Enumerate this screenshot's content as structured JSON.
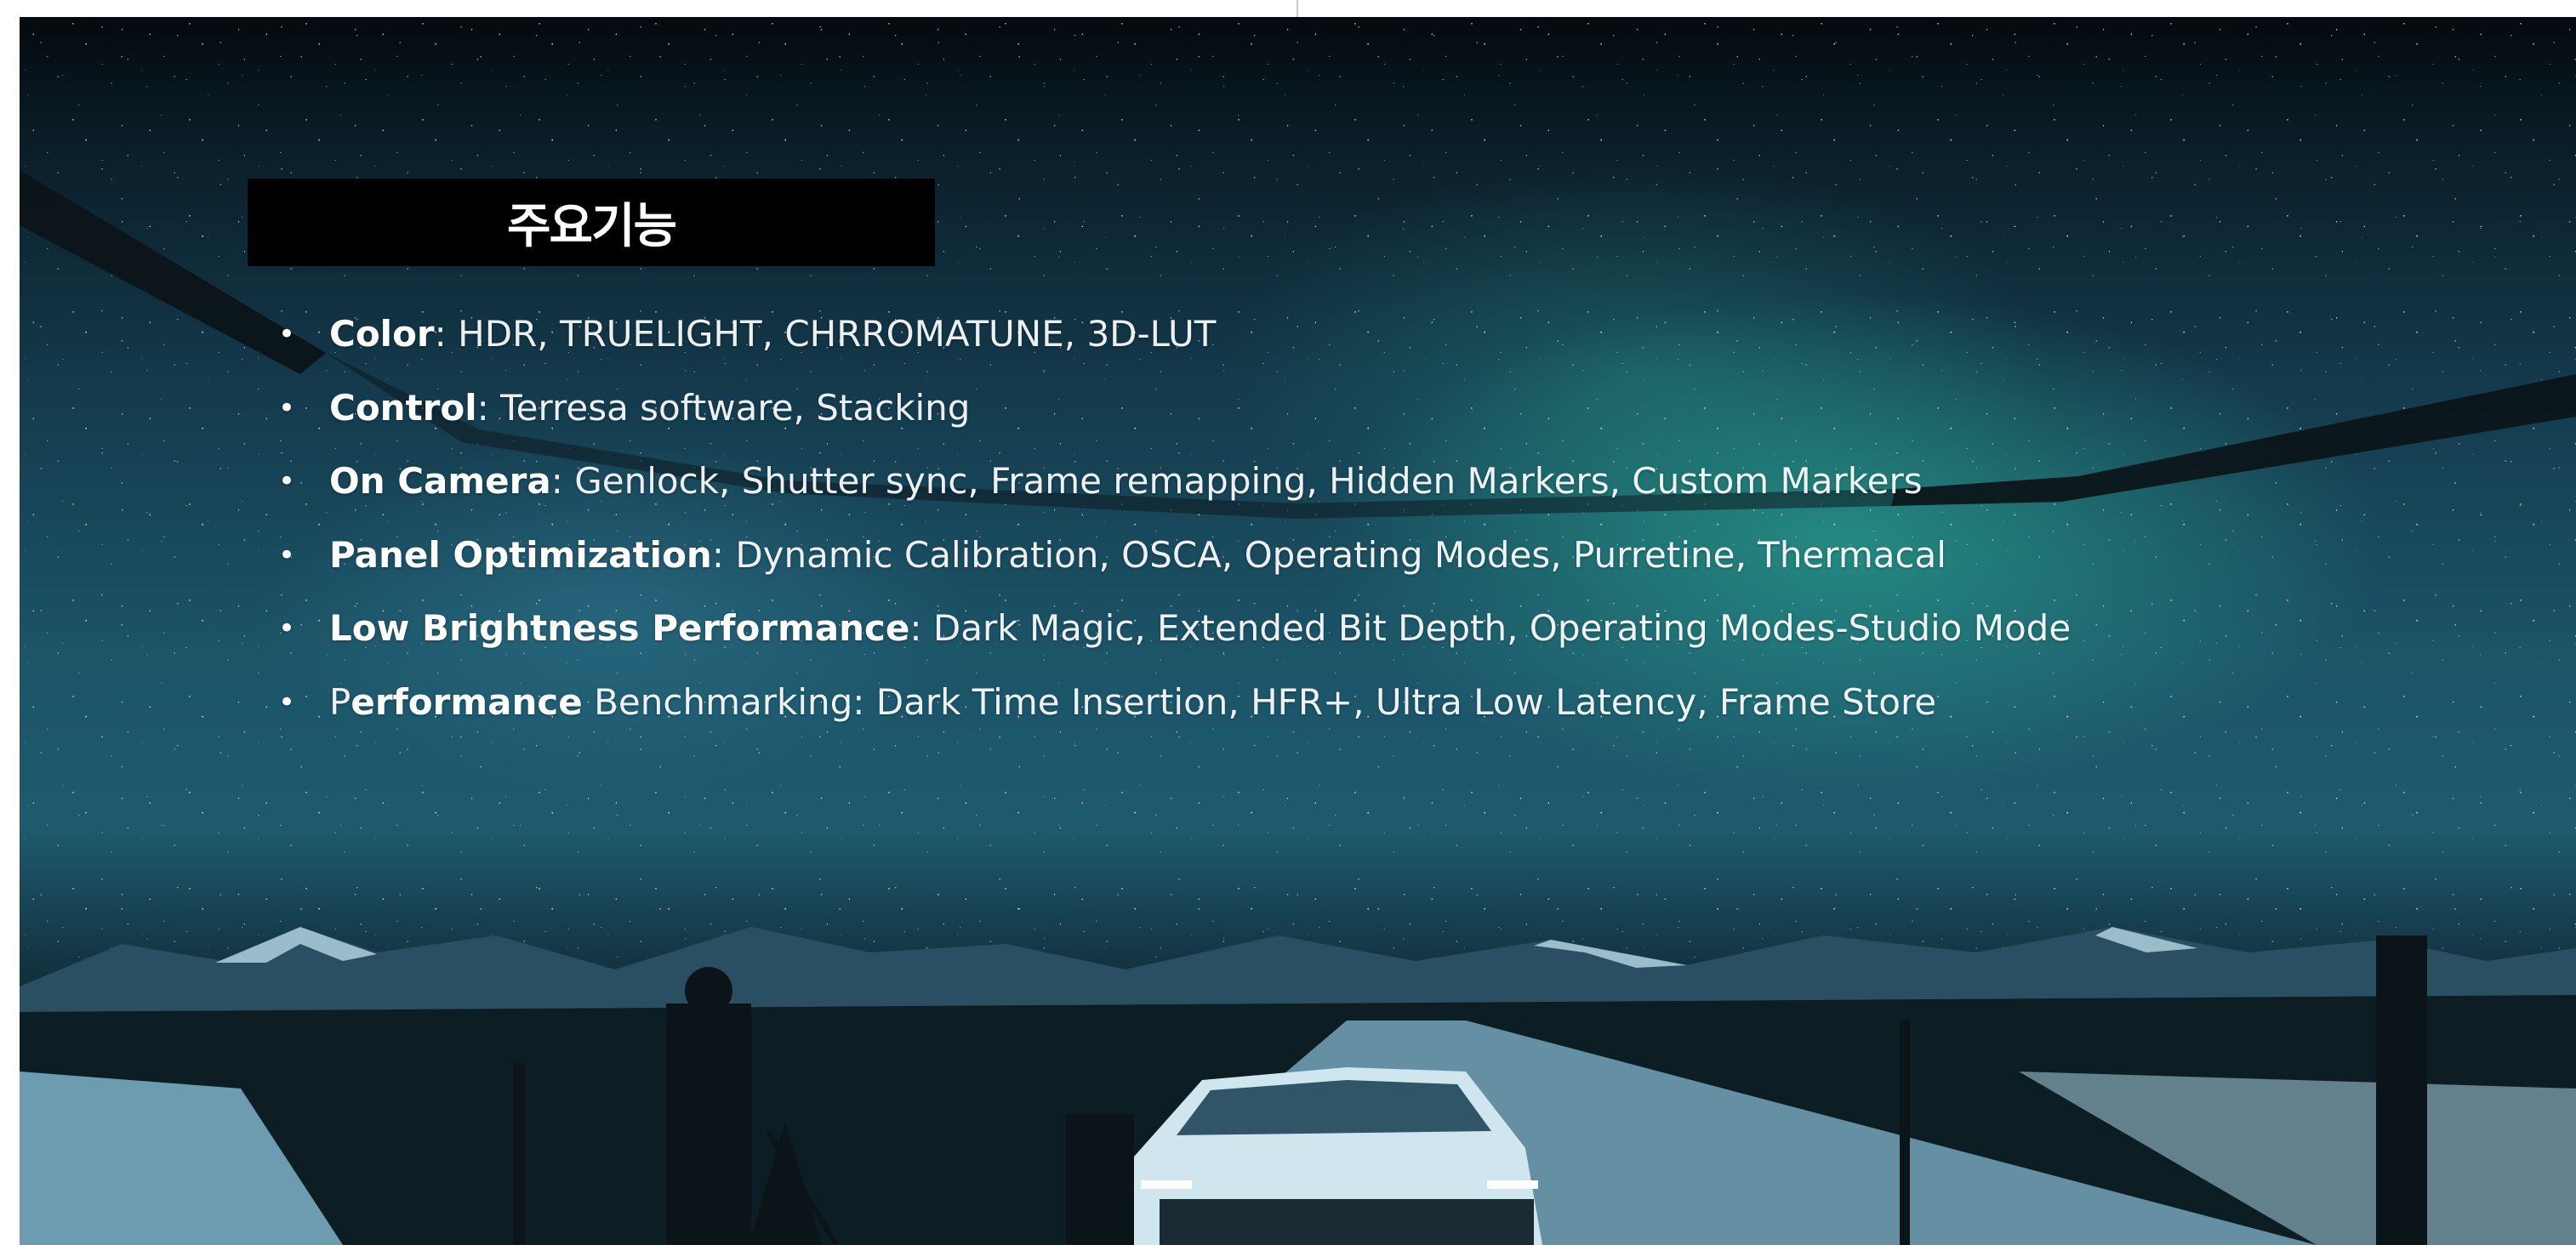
{
  "slide": {
    "title": "주요기능",
    "features": [
      {
        "bold": "Color",
        "rest": ": HDR, TRUELIGHT, CHRROMATUNE, 3D-LUT"
      },
      {
        "bold": "Control",
        "rest": ": Terresa software, Stacking"
      },
      {
        "bold": "On Camera",
        "rest": ": Genlock, Shutter sync, Frame remapping, Hidden Markers, Custom Markers"
      },
      {
        "bold": "Panel Optimization",
        "rest": ": Dynamic Calibration, OSCA, Operating Modes, Purretine, Thermacal"
      },
      {
        "bold": "Low Brightness Performance",
        "rest": ": Dark Magic, Extended Bit Depth, Operating Modes-Studio Mode"
      },
      {
        "lead": "P",
        "bold": "erformance",
        "rest": " Benchmarking: Dark Time Insertion, HFR+, Ultra Low Latency, Frame Store"
      }
    ],
    "bullet": "•"
  }
}
